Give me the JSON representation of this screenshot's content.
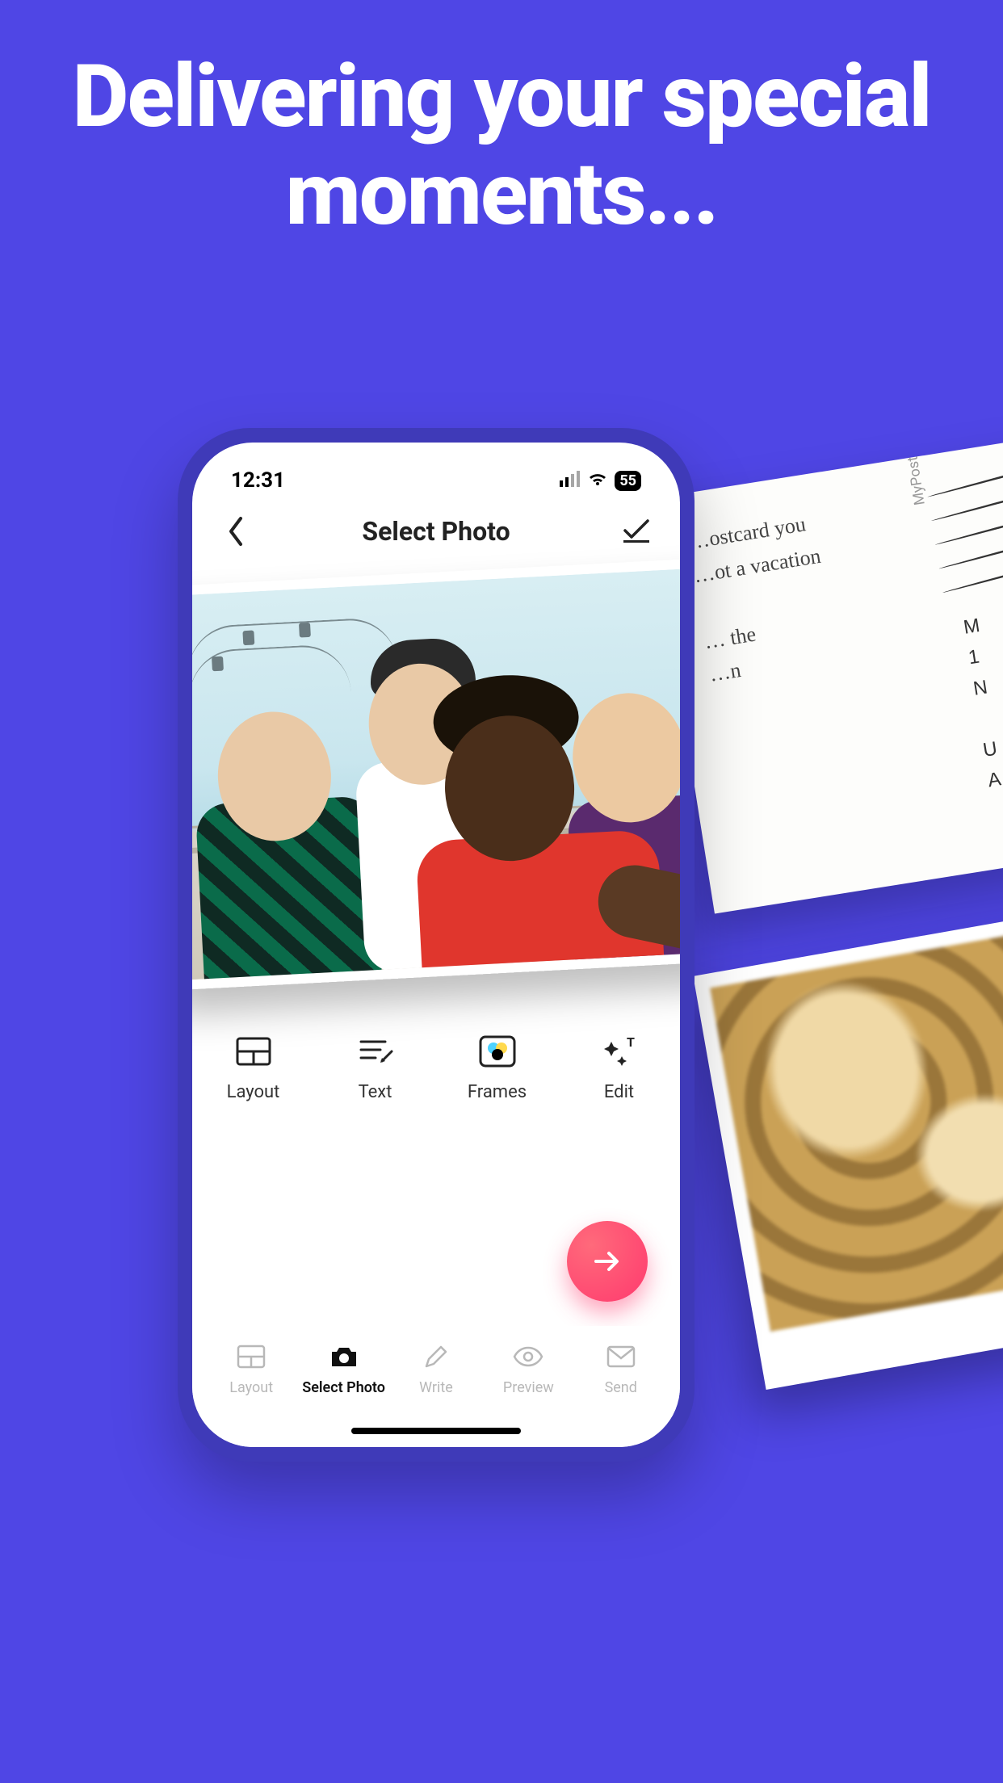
{
  "headline": "Delivering your special moments...",
  "status": {
    "time": "12:31",
    "battery": "55"
  },
  "nav": {
    "title": "Select Photo"
  },
  "tools": {
    "layout": "Layout",
    "text": "Text",
    "frames": "Frames",
    "edit": "Edit"
  },
  "tabs": {
    "layout": "Layout",
    "select_photo": "Select Photo",
    "write": "Write",
    "preview": "Preview",
    "send": "Send",
    "active": "select_photo"
  },
  "postcard": {
    "msg_lines": "…ostcard you\n…ot a vacation\n\n… the\n…n",
    "brand": "MyPostcard.com",
    "address": "M\n1\nN\n\nU\nA"
  }
}
